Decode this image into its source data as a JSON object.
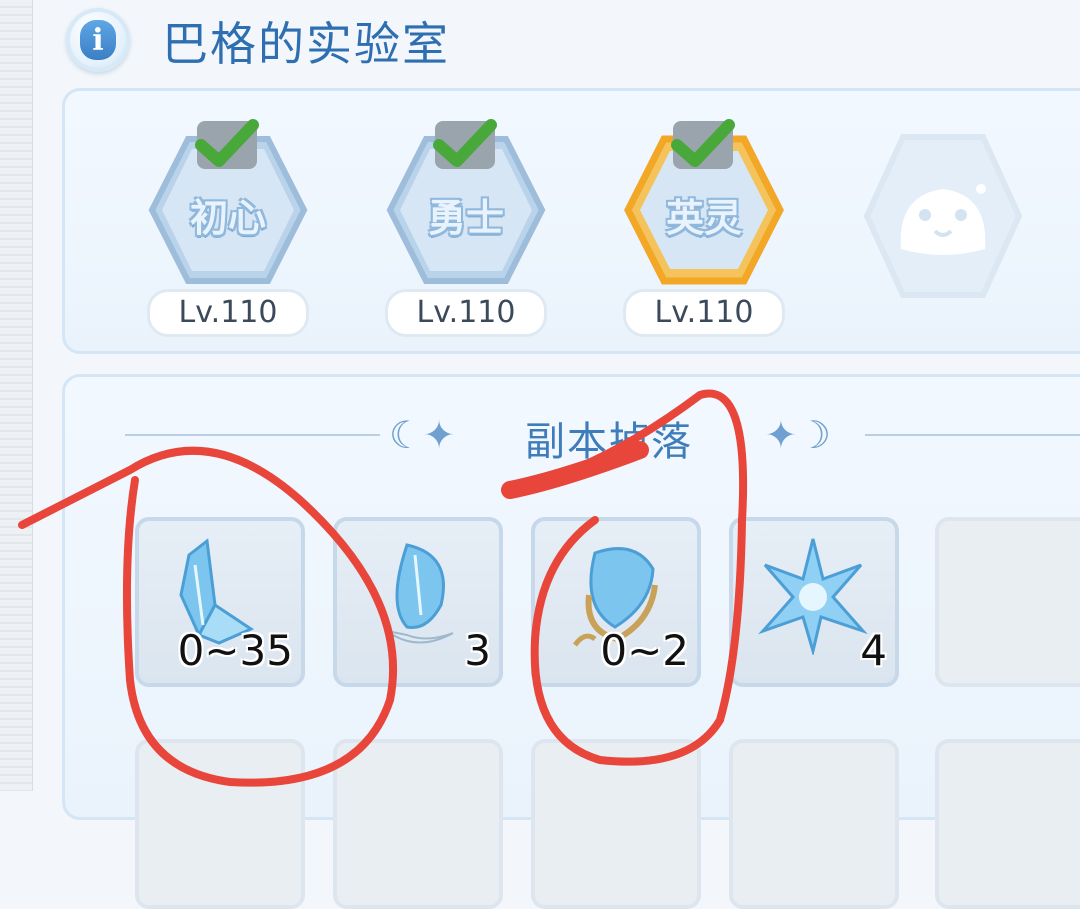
{
  "header": {
    "title": "巴格的实验室",
    "info_icon": "info-icon"
  },
  "ranks": [
    {
      "name": "初心",
      "level": "Lv.110",
      "completed": true,
      "frame": "blue"
    },
    {
      "name": "勇士",
      "level": "Lv.110",
      "completed": true,
      "frame": "blue"
    },
    {
      "name": "英灵",
      "level": "Lv.110",
      "completed": true,
      "frame": "gold"
    },
    {
      "name": "",
      "level": "",
      "completed": false,
      "frame": "locked",
      "icon": "slime-icon"
    }
  ],
  "drops": {
    "section_title": "副本掉落",
    "items": [
      {
        "icon": "blue-crystal-shard-icon",
        "quantity": "0~35"
      },
      {
        "icon": "winged-crystal-icon",
        "quantity": "3"
      },
      {
        "icon": "gold-framed-crystal-icon",
        "quantity": "0~2"
      },
      {
        "icon": "ice-snowflake-crystal-icon",
        "quantity": "4"
      },
      {
        "icon": "",
        "quantity": ""
      }
    ]
  },
  "colors": {
    "title": "#2e6fb2",
    "annotation": "#e8463a",
    "check": "#48a83a",
    "gold_frame": "#f2a726"
  }
}
